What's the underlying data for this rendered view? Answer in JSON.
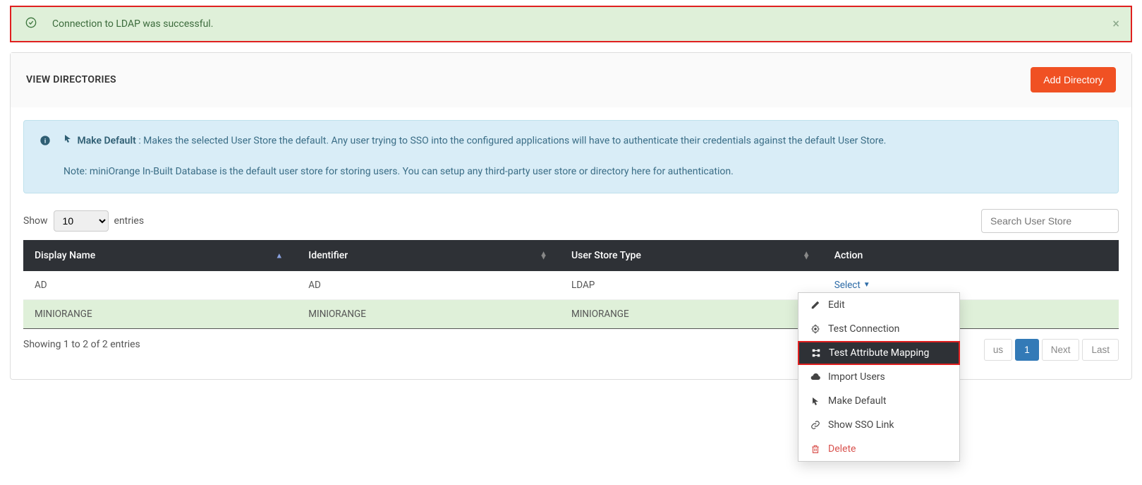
{
  "alert": {
    "text": "Connection to LDAP was successful."
  },
  "panel": {
    "title": "VIEW DIRECTORIES",
    "add_btn": "Add Directory"
  },
  "info": {
    "make_default_label": "Make Default",
    "body": ": Makes the selected User Store the default. Any user trying to SSO into the configured applications will have to authenticate their credentials against the default User Store.",
    "note": "Note: miniOrange In-Built Database is the default user store for storing users. You can setup any third-party user store or directory here for authentication."
  },
  "controls": {
    "show_label": "Show",
    "count": "10",
    "entries_label": "entries",
    "search_placeholder": "Search User Store"
  },
  "table": {
    "headers": {
      "display": "Display Name",
      "identifier": "Identifier",
      "type": "User Store Type",
      "action": "Action"
    },
    "rows": [
      {
        "display": "AD",
        "identifier": "AD",
        "type": "LDAP",
        "action": "Select"
      },
      {
        "display": "MINIORANGE",
        "identifier": "MINIORANGE",
        "type": "MINIORANGE",
        "action": ""
      }
    ],
    "footer": "Showing 1 to 2 of 2 entries"
  },
  "dropdown": {
    "edit": "Edit",
    "test_conn": "Test Connection",
    "test_attr": "Test Attribute Mapping",
    "import": "Import Users",
    "make_default": "Make Default",
    "show_sso": "Show SSO Link",
    "delete": "Delete"
  },
  "pagination": {
    "prev_partial": "us",
    "one": "1",
    "next": "Next",
    "last": "Last"
  }
}
